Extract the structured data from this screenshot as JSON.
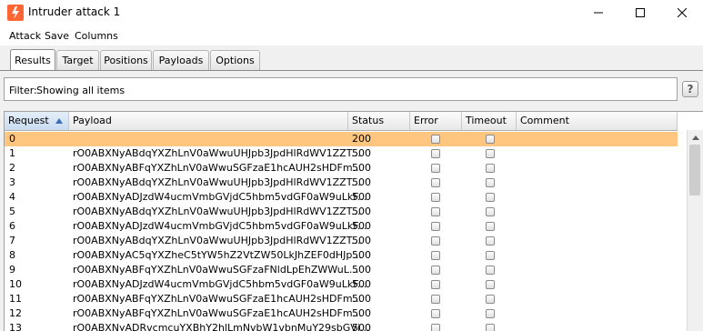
{
  "window": {
    "title": "Intruder attack 1"
  },
  "menu": [
    "Attack",
    "Save",
    "Columns"
  ],
  "tabs": [
    "Results",
    "Target",
    "Positions",
    "Payloads",
    "Options"
  ],
  "active_tab": "Results",
  "filter": {
    "label": "Filter:",
    "value": "Showing all items"
  },
  "help_label": "?",
  "table": {
    "columns": [
      "Request",
      "Payload",
      "Status",
      "Error",
      "Timeout",
      "Comment"
    ],
    "sorted_column": "Request",
    "sort_direction": "ascending",
    "rows": [
      {
        "request": "0",
        "payload": "",
        "status": "200",
        "selected": true
      },
      {
        "request": "1",
        "payload": "rO0ABXNyABdqYXZhLnV0aWwuUHJpb3JpdHlRdWV1ZZT...",
        "status": "500"
      },
      {
        "request": "2",
        "payload": "rO0ABXNyABFqYXZhLnV0aWwuSGFzaE1hcAUH2sHDFm...",
        "status": "500"
      },
      {
        "request": "3",
        "payload": "rO0ABXNyABdqYXZhLnV0aWwuUHJpb3JpdHlRdWV1ZZT...",
        "status": "500"
      },
      {
        "request": "4",
        "payload": "rO0ABXNyADJzdW4ucmVmbGVjdC5hbm5vdGF0aW9uLkF...",
        "status": "500"
      },
      {
        "request": "5",
        "payload": "rO0ABXNyABdqYXZhLnV0aWwuUHJpb3JpdHlRdWV1ZZT...",
        "status": "500"
      },
      {
        "request": "6",
        "payload": "rO0ABXNyADJzdW4ucmVmbGVjdC5hbm5vdGF0aW9uLkF...",
        "status": "500"
      },
      {
        "request": "7",
        "payload": "rO0ABXNyABdqYXZhLnV0aWwuUHJpb3JpdHlRdWV1ZZT...",
        "status": "500"
      },
      {
        "request": "8",
        "payload": "rO0ABXNyAC5qYXZheC5tYW5hZ2VtZW50LkJhZEF0dHJp...",
        "status": "500"
      },
      {
        "request": "9",
        "payload": "rO0ABXNyABFqYXZhLnV0aWwuSGFzaFNldLpEhZWWuL...",
        "status": "500"
      },
      {
        "request": "10",
        "payload": "rO0ABXNyADJzdW4ucmVmbGVjdC5hbm5vdGF0aW9uLkF...",
        "status": "500"
      },
      {
        "request": "11",
        "payload": "rO0ABXNyABFqYXZhLnV0aWwuSGFzaE1hcAUH2sHDFm...",
        "status": "500"
      },
      {
        "request": "12",
        "payload": "rO0ABXNyABFqYXZhLnV0aWwuSGFzaE1hcAUH2sHDFm...",
        "status": "500"
      },
      {
        "request": "13",
        "payload": "rO0ABXNyADRvcmcuYXBhY2hlLmNvbW1vbnMuY29sbGVj...",
        "status": "500"
      }
    ]
  },
  "colors": {
    "selected_row": "#ffc680",
    "sorted_header": "#c9dcf1",
    "app_icon": "#ff6633"
  },
  "icons": [
    "burp-app-icon",
    "minimize-icon",
    "maximize-icon",
    "close-icon",
    "sort-ascending-icon",
    "scroll-up-icon"
  ]
}
